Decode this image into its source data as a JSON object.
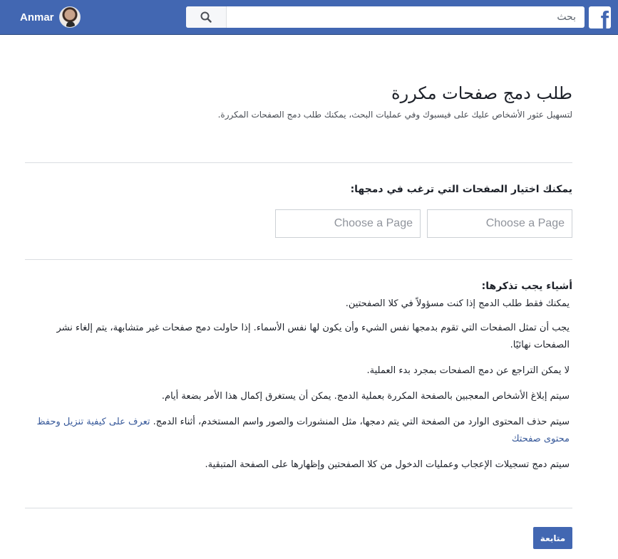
{
  "header": {
    "user_name": "Anmar",
    "search_placeholder": "بحث",
    "logo_letter": "f",
    "brand_color": "#4267b2"
  },
  "page": {
    "title": "طلب دمج صفحات مكررة",
    "subtitle": "لتسهيل عثور الأشخاص عليك على فيسبوك وفي عمليات البحث، يمكنك طلب دمج الصفحات المكررة."
  },
  "choose": {
    "heading": "يمكنك اختيار الصفحات التي ترغب في دمجها:",
    "page_1_placeholder": "Choose a Page",
    "page_2_placeholder": "Choose a Page"
  },
  "remember": {
    "heading": "أشياء يجب تذكرها:",
    "items": [
      {
        "text": "يمكنك فقط طلب الدمج إذا كنت مسؤولاً في كلا الصفحتين."
      },
      {
        "text": "يجب أن تمثل الصفحات التي تقوم بدمجها نفس الشيء وأن يكون لها نفس الأسماء. إذا حاولت دمج صفحات غير متشابهة، يتم إلغاء نشر الصفحات نهائيًا."
      },
      {
        "text": "لا يمكن التراجع عن دمج الصفحات بمجرد بدء العملية."
      },
      {
        "text": "سيتم إبلاغ الأشخاص المعجبين بالصفحة المكررة بعملية الدمج. يمكن أن يستغرق إكمال هذا الأمر بضعة أيام."
      },
      {
        "text": "سيتم حذف المحتوى الوارد من الصفحة التي يتم دمجها، مثل المنشورات والصور واسم المستخدم، أثناء الدمج.",
        "link": "تعرف على كيفية تنزيل وحفظ محتوى صفحتك"
      },
      {
        "text": "سيتم دمج تسجيلات الإعجاب وعمليات الدخول من كلا الصفحتين وإظهارها على الصفحة المتبقية."
      }
    ]
  },
  "actions": {
    "continue_label": "متابعة"
  }
}
